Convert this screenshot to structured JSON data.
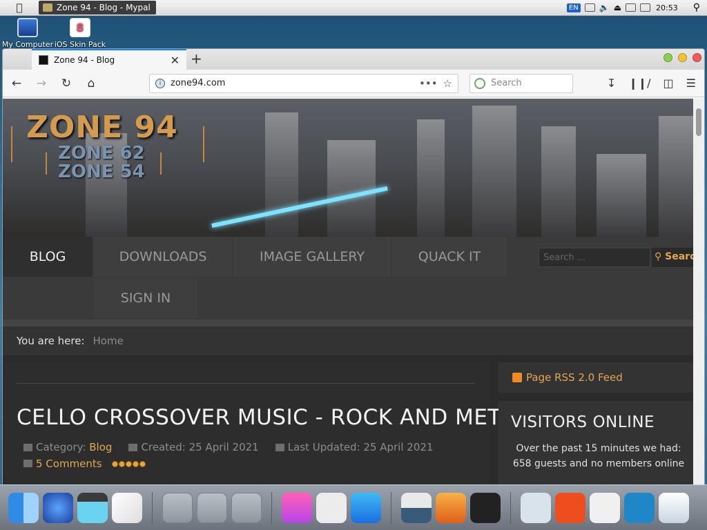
{
  "menubar": {
    "app_title": "Zone 94 - Blog - Mypal",
    "language": "EN",
    "clock": "20:53"
  },
  "desktop": {
    "icons": [
      {
        "label": "My Computer"
      },
      {
        "label": "iOS Skin Pack"
      }
    ]
  },
  "browser": {
    "tab_title": "Zone 94 - Blog",
    "new_tab": "+",
    "url": "zone94.com",
    "search_placeholder": "Search"
  },
  "site": {
    "logo_main": "ZONE 94",
    "logo_sub1": "ZONE 62",
    "logo_sub2": "ZONE 54",
    "menu": {
      "blog": "BLOG",
      "downloads": "DOWNLOADS",
      "image_gallery": "IMAGE GALLERY",
      "quack_it": "QUACK IT",
      "sign_in": "SIGN IN"
    },
    "search_placeholder": "Search ...",
    "search_button": "Search",
    "breadcrumb": {
      "label": "You are here:",
      "home": "Home"
    },
    "post": {
      "title": "CELLO CROSSOVER MUSIC - ROCK AND METAL",
      "category_label": "Category:",
      "category": "Blog",
      "created": "Created: 25 April 2021",
      "updated": "Last Updated: 25 April 2021",
      "comments": "5 Comments",
      "rating": 5
    },
    "sidebar": {
      "rss": "Page RSS 2.0 Feed",
      "visitors_title": "VISITORS ONLINE",
      "visitors_text": "Over the past 15 minutes we had: 658 guests and no members online"
    }
  },
  "colors": {
    "accent": "#e0a84f",
    "content_bg": "#2b2b2b",
    "tab_highlight": "#0a84ff"
  }
}
